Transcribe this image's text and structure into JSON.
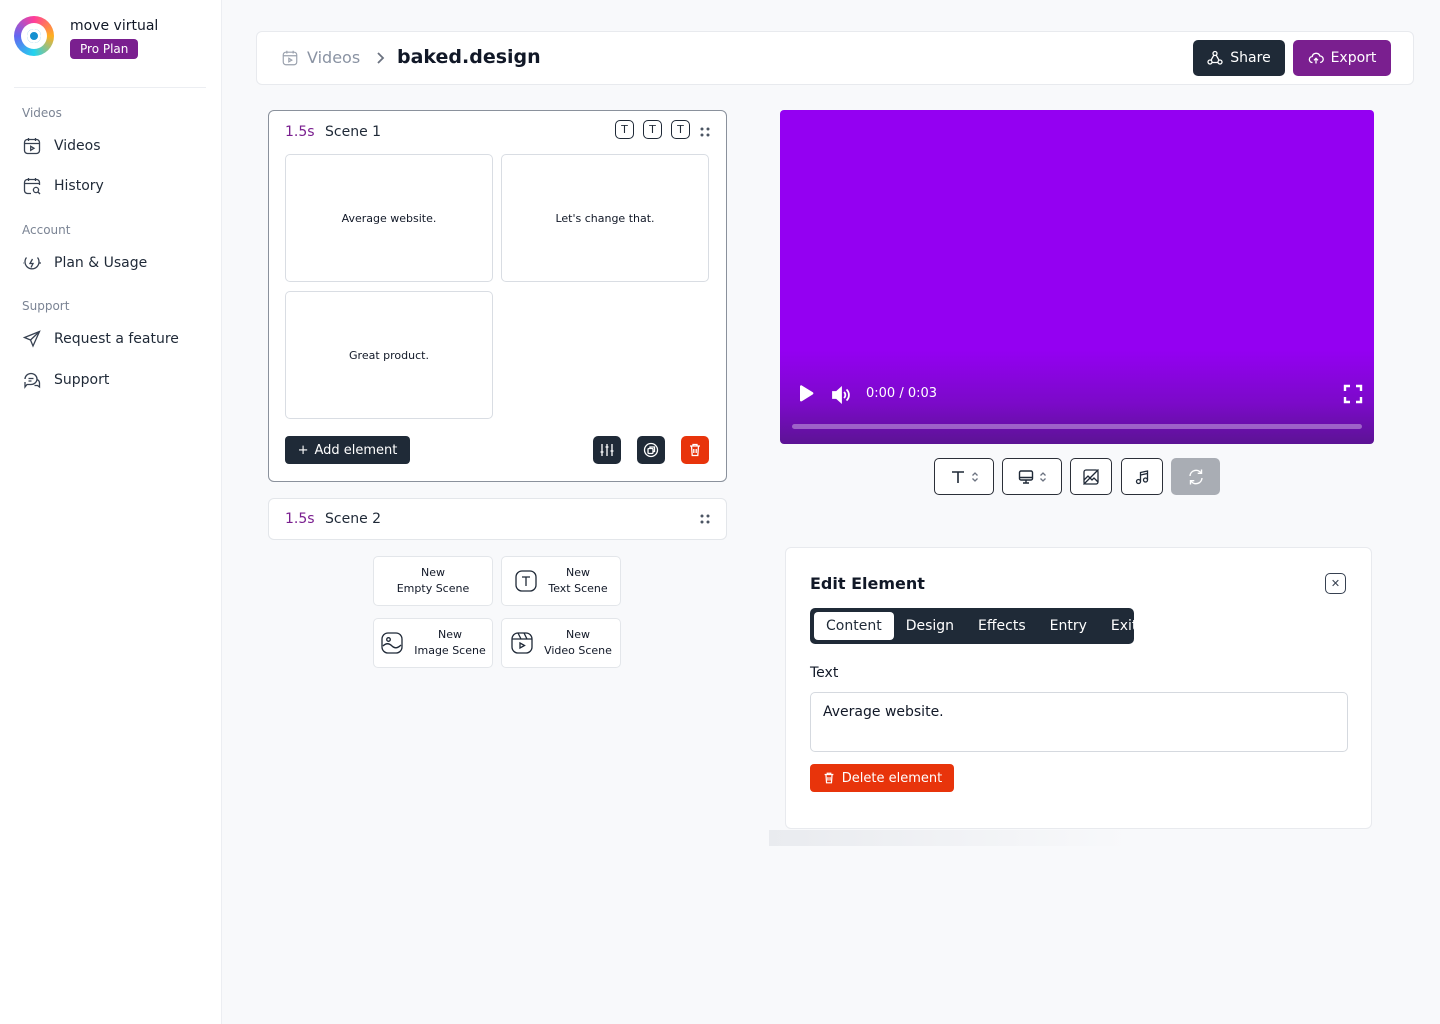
{
  "brand": {
    "name": "move virtual",
    "plan": "Pro Plan"
  },
  "sidebar": {
    "sections": [
      {
        "label": "Videos",
        "items": [
          {
            "label": "Videos",
            "icon": "video-calendar-icon"
          },
          {
            "label": "History",
            "icon": "calendar-search-icon"
          }
        ]
      },
      {
        "label": "Account",
        "items": [
          {
            "label": "Plan & Usage",
            "icon": "billing-icon"
          }
        ]
      },
      {
        "label": "Support",
        "items": [
          {
            "label": "Request a feature",
            "icon": "send-icon"
          },
          {
            "label": "Support",
            "icon": "chat-icon"
          }
        ]
      }
    ]
  },
  "header": {
    "breadcrumb_root": "Videos",
    "breadcrumb_current": "baked.design",
    "share_label": "Share",
    "export_label": "Export"
  },
  "scenes": [
    {
      "duration": "1.5s",
      "name": "Scene 1",
      "elements": [
        "Average website.",
        "Let's change that.",
        "Great product."
      ],
      "add_label": "Add element"
    },
    {
      "duration": "1.5s",
      "name": "Scene 2"
    }
  ],
  "new_scene": {
    "empty": {
      "line1": "New",
      "line2": "Empty Scene"
    },
    "text": {
      "line1": "New",
      "line2": "Text Scene"
    },
    "image": {
      "line1": "New",
      "line2": "Image Scene"
    },
    "video": {
      "line1": "New",
      "line2": "Video Scene"
    }
  },
  "player": {
    "time": "0:00 / 0:03",
    "progress": 0,
    "background": "#9400f2"
  },
  "edit": {
    "title": "Edit Element",
    "tabs": [
      "Content",
      "Design",
      "Effects",
      "Entry",
      "Exit"
    ],
    "active_tab": "Content",
    "field_label": "Text",
    "field_value": "Average website.",
    "delete_label": "Delete element"
  },
  "colors": {
    "accent": "#7a1f8f",
    "dark": "#1f2a37",
    "danger": "#e8340b"
  }
}
